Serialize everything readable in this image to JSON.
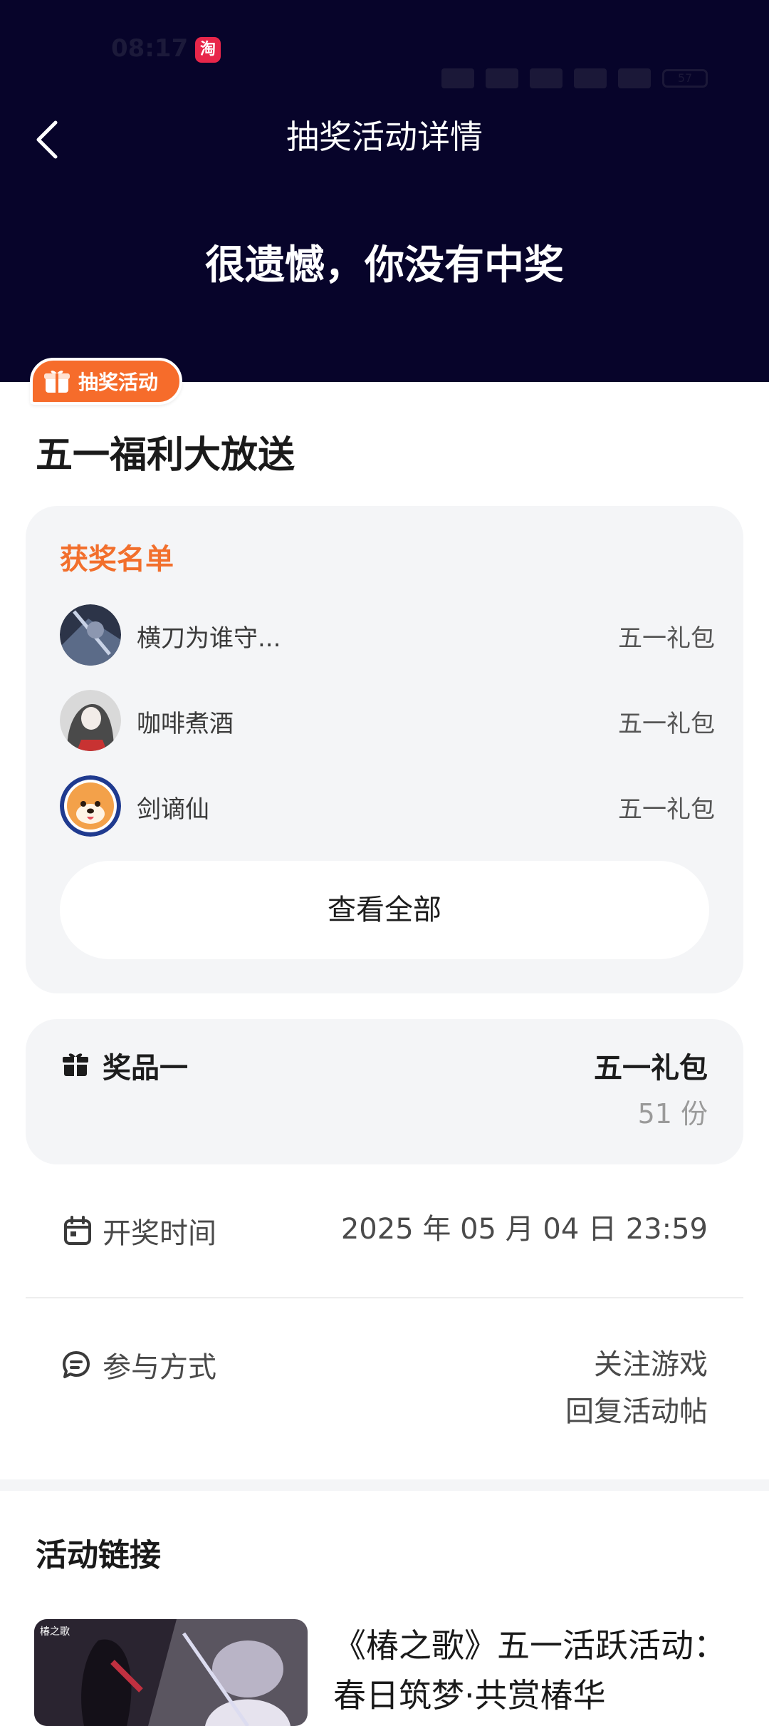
{
  "status_bar": {
    "time": "08:17",
    "app_icon": "淘",
    "battery": "57"
  },
  "header": {
    "title": "抽奖活动详情",
    "result": "很遗憾，你没有中奖"
  },
  "activity": {
    "tag": "抽奖活动",
    "title": "五一福利大放送"
  },
  "winners": {
    "heading": "获奖名单",
    "list": [
      {
        "name": "横刀为谁守...",
        "prize": "五一礼包"
      },
      {
        "name": "咖啡煮酒",
        "prize": "五一礼包"
      },
      {
        "name": "剑谪仙",
        "prize": "五一礼包"
      }
    ],
    "view_all": "查看全部"
  },
  "prize": {
    "label": "奖品一",
    "name": "五一礼包",
    "count": "51 份"
  },
  "draw_time": {
    "label": "开奖时间",
    "value": "2025 年 05 月 04 日 23:59"
  },
  "participation": {
    "label": "参与方式",
    "line1": "关注游戏",
    "line2": "回复活动帖"
  },
  "links": {
    "heading": "活动链接",
    "thumb_text": "椿之歌",
    "title": "《椿之歌》五一活跃活动：春日筑梦·共赏椿华"
  },
  "colors": {
    "header_bg": "#07042a",
    "accent": "#f26f2c",
    "card_bg": "#f4f5f7"
  }
}
